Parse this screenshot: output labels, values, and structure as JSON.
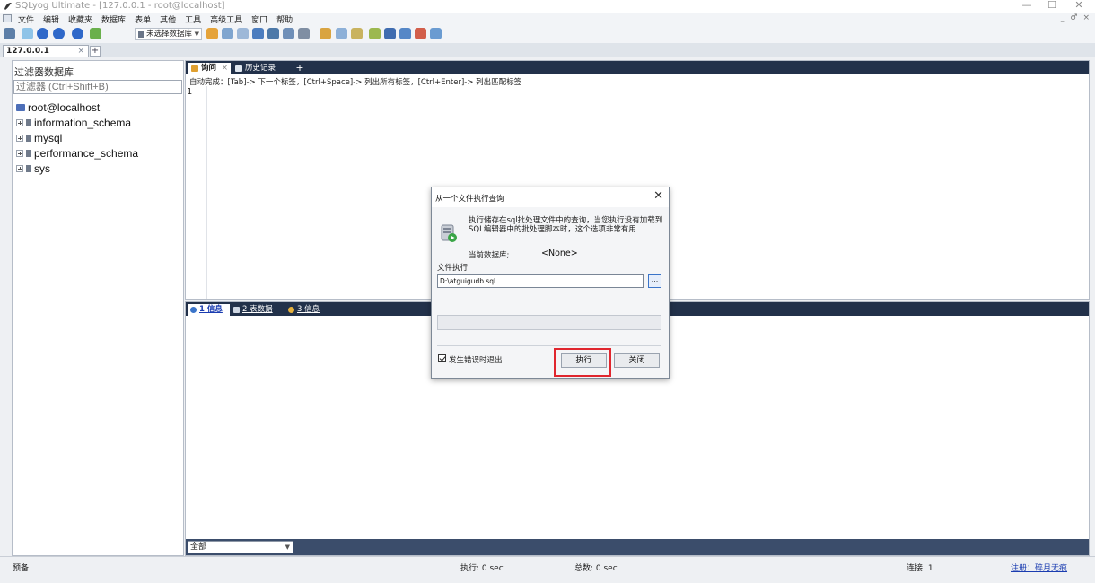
{
  "window": {
    "title": "SQLyog Ultimate - [127.0.0.1 - root@localhost]",
    "controls": [
      "—",
      "☐",
      "✕"
    ],
    "mdi_controls": [
      "_",
      "♂",
      "×"
    ]
  },
  "menu": {
    "items": [
      "文件",
      "编辑",
      "收藏夹",
      "数据库",
      "表单",
      "其他",
      "工具",
      "高级工具",
      "窗口",
      "帮助"
    ]
  },
  "toolbar": {
    "db_select_value": "未选择数据库"
  },
  "connection_tabs": {
    "active": "127.0.0.1",
    "close": "×",
    "add": "+"
  },
  "object_browser": {
    "filter_label": "过滤器数据库",
    "filter_placeholder": "过滤器 (Ctrl+Shift+B)",
    "root": "root@localhost",
    "databases": [
      "information_schema",
      "mysql",
      "performance_schema",
      "sys"
    ]
  },
  "query_editor": {
    "tabs": [
      {
        "label": "询问",
        "close": "×"
      },
      {
        "label": "历史记录"
      }
    ],
    "add": "+",
    "autocomplete_hint": "自动完成：[Tab]-> 下一个标签，[Ctrl+Space]-> 列出所有标签，[Ctrl+Enter]-> 列出匹配标签",
    "line_number": "1"
  },
  "result_panel": {
    "tabs": [
      "1 信息",
      "2 表数据",
      "3 信息"
    ],
    "filter_value": "全部"
  },
  "status_bar": {
    "ready": "预备",
    "exec": "执行: 0 sec",
    "total": "总数: 0 sec",
    "connections": "连接: 1",
    "register": "注册：碎月无痕"
  },
  "dialog": {
    "title": "从一个文件执行查询",
    "close": "✕",
    "description": "执行储存在sql批处理文件中的查询，当您执行没有加载到SQL编辑器中的批处理脚本时，这个选项非常有用",
    "current_db_label": "当前数据库;",
    "current_db_value": "<None>",
    "file_label": "文件执行",
    "file_path": "D:\\atguigudb.sql",
    "browse": "...",
    "checkbox_label": "发生错误时退出",
    "checkbox_checked": true,
    "execute_button": "执行",
    "close_button": "关闭",
    "highlight_color": "#e0262e"
  },
  "colors": {
    "tab_bar": "#22314a",
    "footer_bar": "#3b4d6b",
    "link": "#1a3cb0"
  }
}
